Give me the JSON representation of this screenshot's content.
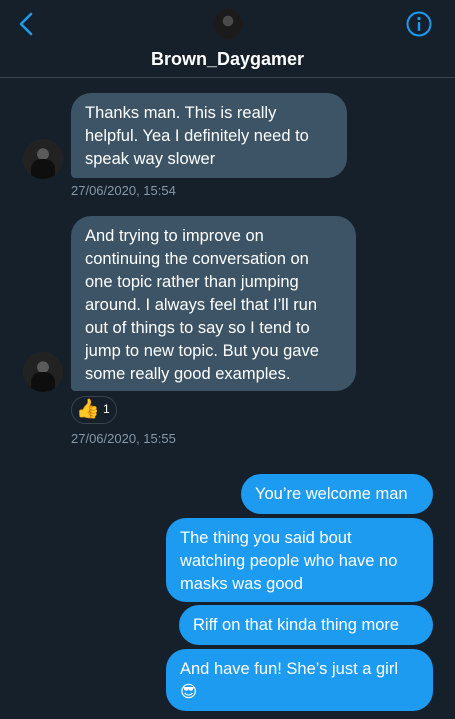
{
  "header": {
    "contact_name": "Brown_Daygamer"
  },
  "messages": {
    "incoming": [
      {
        "text": "Thanks man. This is really\nhelpful. Yea I definitely need to\nspeak way slower",
        "timestamp": "27/06/2020, 15:54"
      },
      {
        "text": "And trying to improve on\ncontinuing the conversation on\none topic rather than jumping\naround. I always feel that I’ll run\nout of things to say so I tend to\njump to new topic. But you gave\nsome really good examples.",
        "timestamp": "27/06/2020, 15:55",
        "reaction": {
          "emoji": "👍",
          "count": "1"
        }
      }
    ],
    "outgoing": [
      {
        "text": "You’re welcome man"
      },
      {
        "text": "The thing you said bout\nwatching people who have no\nmasks was good"
      },
      {
        "text": "Riff on that kinda thing more"
      },
      {
        "text": "And have fun! She’s just a girl\n😎"
      }
    ]
  },
  "colors": {
    "background": "#15202b",
    "incoming_bubble": "#3d5466",
    "outgoing_bubble": "#1d9bf0",
    "accent": "#1d9bf0",
    "muted_text": "#8899a6"
  },
  "icons": {
    "back": "chevron-left-icon",
    "info": "info-icon"
  }
}
